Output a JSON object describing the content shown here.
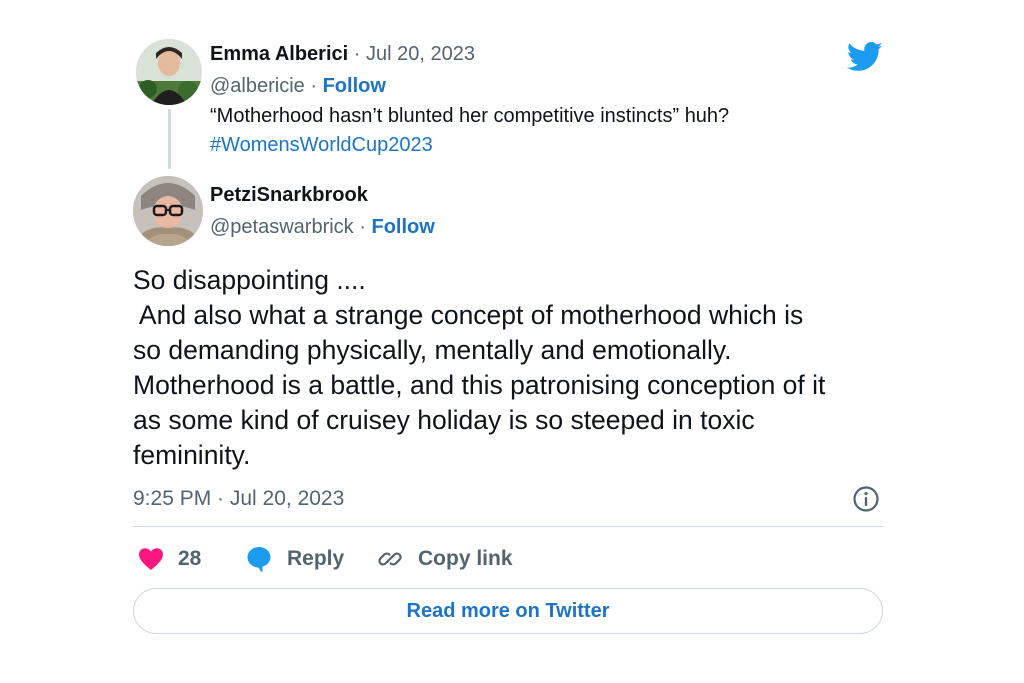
{
  "quoted_tweet": {
    "display_name": "Emma Alberici",
    "separator": "·",
    "date": "Jul 20, 2023",
    "handle": "@albericie",
    "follow_label": "Follow",
    "text": "“Motherhood hasn’t blunted her competitive instincts” huh?",
    "hashtag": "#WomensWorldCup2023",
    "avatar_icon": "profile-photo"
  },
  "tweet": {
    "display_name": "PetziSnarkbrook",
    "handle": "@petaswarbrick",
    "separator": "·",
    "follow_label": "Follow",
    "text_lines": [
      "So disappointing ....",
      " And also what a strange concept of motherhood which is",
      "so demanding physically, mentally and emotionally.",
      "Motherhood is a battle, and this patronising conception of it",
      "as some kind of cruisey holiday is so steeped in toxic",
      "femininity."
    ],
    "timestamp": "9:25 PM · Jul 20, 2023",
    "avatar_icon": "profile-photo"
  },
  "actions": {
    "like_count": "28",
    "reply_label": "Reply",
    "copy_link_label": "Copy link"
  },
  "read_more_label": "Read more on Twitter",
  "icons": {
    "brand": "twitter-bird-icon",
    "info": "info-icon",
    "like": "heart-icon",
    "reply": "speech-bubble-icon",
    "copy_link": "link-icon"
  },
  "colors": {
    "twitter_blue": "#1d9bf0",
    "link_blue": "#1d74c5",
    "like_pink": "#f91880",
    "muted_text": "#536471",
    "border": "#cfd9de"
  }
}
